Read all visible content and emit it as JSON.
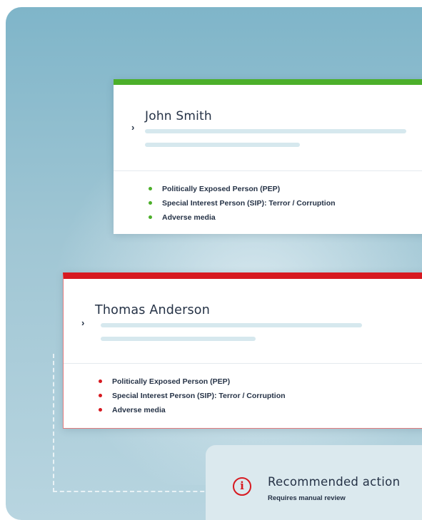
{
  "profiles": [
    {
      "name": "John Smith",
      "status_color": "#4caf2a",
      "flags": [
        "Politically Exposed Person (PEP)",
        "Special Interest Person (SIP):  Terror / Corruption",
        "Adverse media"
      ]
    },
    {
      "name": "Thomas Anderson",
      "status_color": "#d71920",
      "flags": [
        "Politically Exposed Person (PEP)",
        "Special Interest Person (SIP):  Terror / Corruption",
        "Adverse media"
      ]
    }
  ],
  "recommendation": {
    "title": "Recommended action",
    "subtitle": "Requires manual review",
    "icon": "info-icon"
  },
  "colors": {
    "background": "#7fb5c9",
    "accent_text": "#253246"
  }
}
